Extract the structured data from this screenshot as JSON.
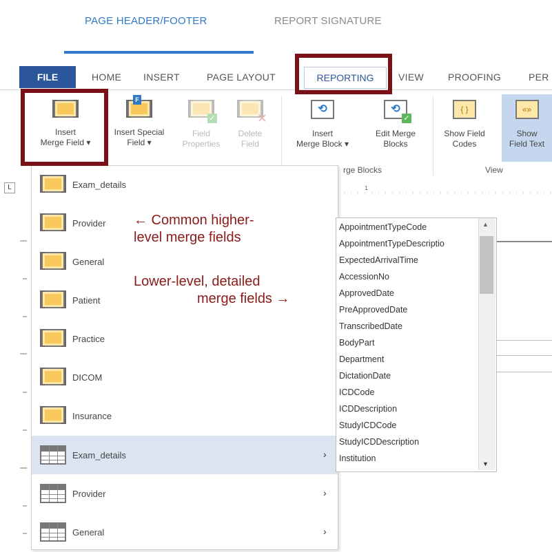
{
  "top_tabs": [
    "PAGE HEADER/FOOTER",
    "REPORT SIGNATURE"
  ],
  "menu": {
    "file": "FILE",
    "items": [
      "HOME",
      "INSERT",
      "PAGE LAYOUT",
      "REPORTING",
      "VIEW",
      "PROOFING",
      "PER"
    ]
  },
  "ribbon": {
    "insert_merge_field": [
      "Insert",
      "Merge Field ▾"
    ],
    "insert_special_field": [
      "Insert Special",
      "Field ▾"
    ],
    "field_properties": [
      "Field",
      "Properties"
    ],
    "delete_field": [
      "Delete",
      "Field"
    ],
    "insert_merge_block": [
      "Insert",
      "Merge Block ▾"
    ],
    "edit_merge_blocks": [
      "Edit Merge",
      "Blocks"
    ],
    "show_field_codes": [
      "Show Field",
      "Codes"
    ],
    "show_field_text": [
      "Show",
      "Field Text"
    ],
    "group_merge_blocks": "rge Blocks",
    "group_view": "View"
  },
  "dropdown": {
    "fields": [
      "Exam_details",
      "Provider",
      "General",
      "Patient",
      "Practice",
      "DICOM",
      "Insurance"
    ],
    "blocks": [
      "Exam_details",
      "Provider",
      "General"
    ]
  },
  "field_list": [
    "AppointmentTypeCode",
    "AppointmentTypeDescriptio",
    "ExpectedArrivalTime",
    "AccessionNo",
    "ApprovedDate",
    "PreApprovedDate",
    "TranscribedDate",
    "BodyPart",
    "Department",
    "DictationDate",
    "ICDCode",
    "ICDDescription",
    "StudyICDCode",
    "StudyICDDescription",
    "Institution"
  ],
  "annotations": {
    "higher": [
      "← Common higher-",
      "level merge fields"
    ],
    "lower": [
      "Lower-level, detailed",
      "merge fields →"
    ]
  },
  "colors": {
    "accent": "#2f79c8",
    "file_tab": "#2b579a",
    "annotation": "#8b1a1a",
    "highlight_box": "#7b1018",
    "selected_row": "#dbe5f1"
  }
}
